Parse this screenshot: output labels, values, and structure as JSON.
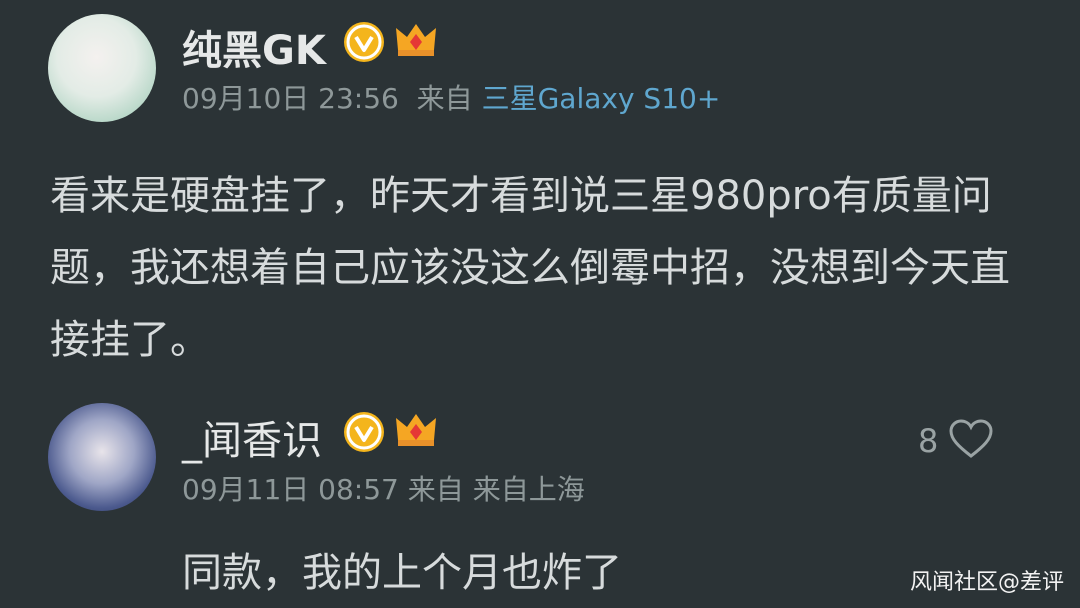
{
  "post": {
    "username": "纯黑GK",
    "date": "09月10日 23:56",
    "from_prefix": "来自",
    "device": "三星Galaxy S10+",
    "text": "看来是硬盘挂了，昨天才看到说三星980pro有质量问题，我还想着自己应该没这么倒霉中招，没想到今天直接挂了。"
  },
  "comment": {
    "username": "_闻香识",
    "date": "09月11日 08:57",
    "from_prefix": "来自",
    "location": "来自上海",
    "likes": "8",
    "text": "同款，我的上个月也炸了"
  },
  "watermark": "风闻社区@差评",
  "colors": {
    "background": "#2b3336",
    "link": "#5fa7cf",
    "badge": "#f4b51c"
  },
  "icons": [
    "verified-badge-icon",
    "crown-icon",
    "heart-icon"
  ]
}
